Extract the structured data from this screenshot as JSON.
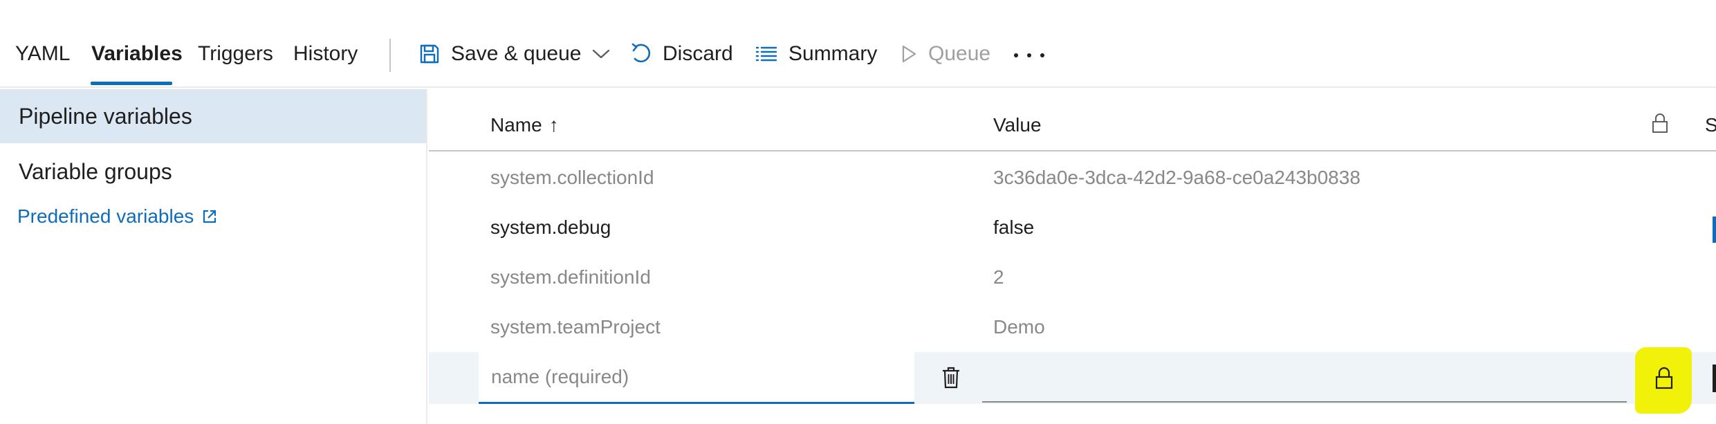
{
  "toolbar": {
    "tabs": [
      {
        "label": "YAML"
      },
      {
        "label": "Variables",
        "active": true
      },
      {
        "label": "Triggers"
      },
      {
        "label": "History"
      }
    ],
    "commands": {
      "save_queue": "Save & queue",
      "discard": "Discard",
      "summary": "Summary",
      "queue": "Queue"
    },
    "icons": [
      "save-icon",
      "chevron-down-icon",
      "undo-icon",
      "list-icon",
      "play-icon",
      "more-icon"
    ]
  },
  "leftnav": {
    "items": [
      {
        "label": "Pipeline variables",
        "selected": true
      },
      {
        "label": "Variable groups"
      }
    ],
    "link": {
      "label": "Predefined variables",
      "icon": "open-external-icon"
    }
  },
  "grid": {
    "columns": {
      "name": "Name",
      "name_sort": "↑",
      "value": "Value",
      "lock_icon": "lock-icon",
      "settable": "S"
    },
    "rows": [
      {
        "name": "system.collectionId",
        "value": "3c36da0e-3dca-42d2-9a68-ce0a243b0838",
        "editable": false
      },
      {
        "name": "system.debug",
        "value": "false",
        "editable": true
      },
      {
        "name": "system.definitionId",
        "value": "2",
        "editable": false
      },
      {
        "name": "system.teamProject",
        "value": "Demo",
        "editable": false
      }
    ],
    "new_row": {
      "name_placeholder": "name (required)",
      "value": ""
    }
  },
  "colors": {
    "accent": "#0f6cbd",
    "selected_bg": "#dbe8f4",
    "new_row_bg": "#eff4f9",
    "highlight": "#f2f10a",
    "muted_text": "#8a8886"
  }
}
